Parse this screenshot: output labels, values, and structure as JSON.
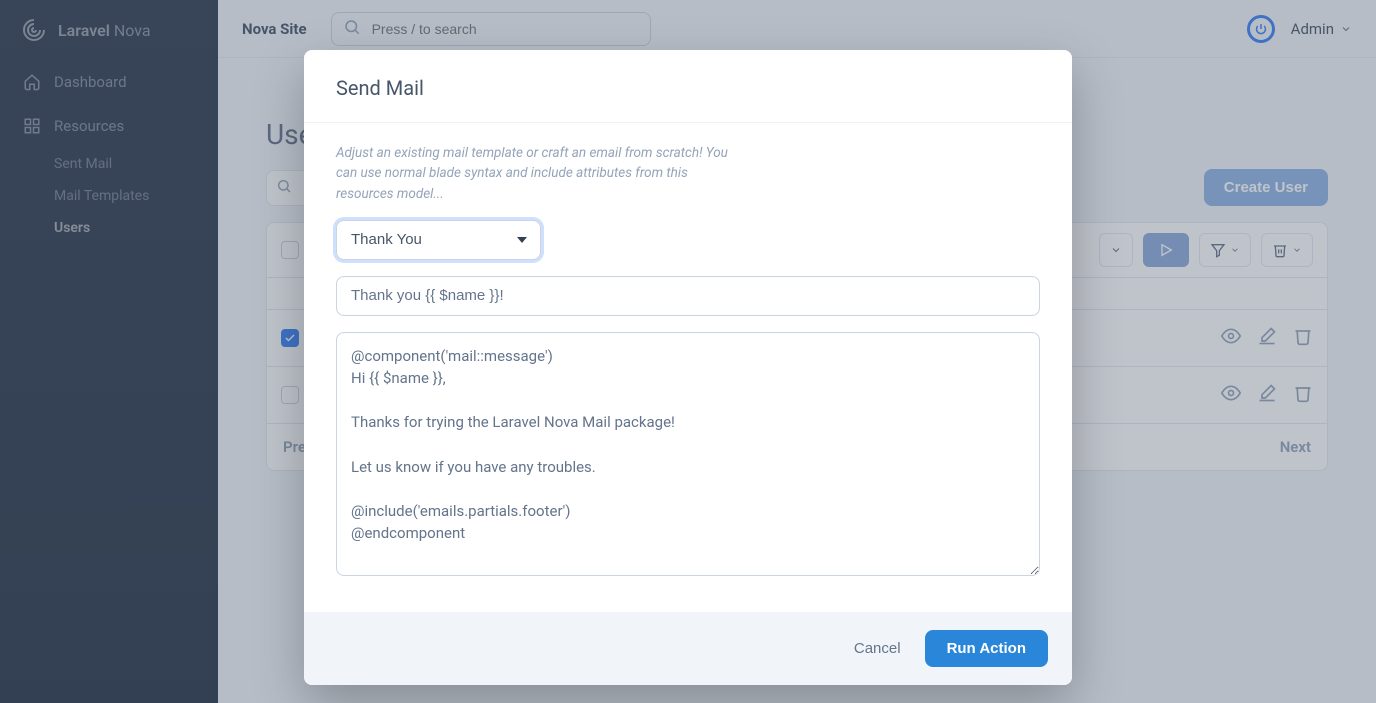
{
  "brand": {
    "name": "Laravel",
    "suffix": "Nova"
  },
  "topbar": {
    "site_name": "Nova Site",
    "search_placeholder": "Press / to search",
    "user_label": "Admin"
  },
  "sidebar": {
    "dashboard": "Dashboard",
    "resources": "Resources",
    "items": [
      {
        "label": "Sent Mail"
      },
      {
        "label": "Mail Templates"
      },
      {
        "label": "Users"
      }
    ]
  },
  "page": {
    "title": "Users",
    "create_label": "Create User",
    "prev": "Previous",
    "next": "Next"
  },
  "modal": {
    "title": "Send Mail",
    "help": "Adjust an existing mail template or craft an email from scratch! You can use normal blade syntax and include attributes from this resources model...",
    "template_selected": "Thank You",
    "subject": "Thank you {{ $name }}!",
    "body": "@component('mail::message')\nHi {{ $name }},\n\nThanks for trying the Laravel Nova Mail package!\n\nLet us know if you have any troubles.\n\n@include('emails.partials.footer')\n@endcomponent",
    "cancel": "Cancel",
    "run": "Run Action"
  }
}
